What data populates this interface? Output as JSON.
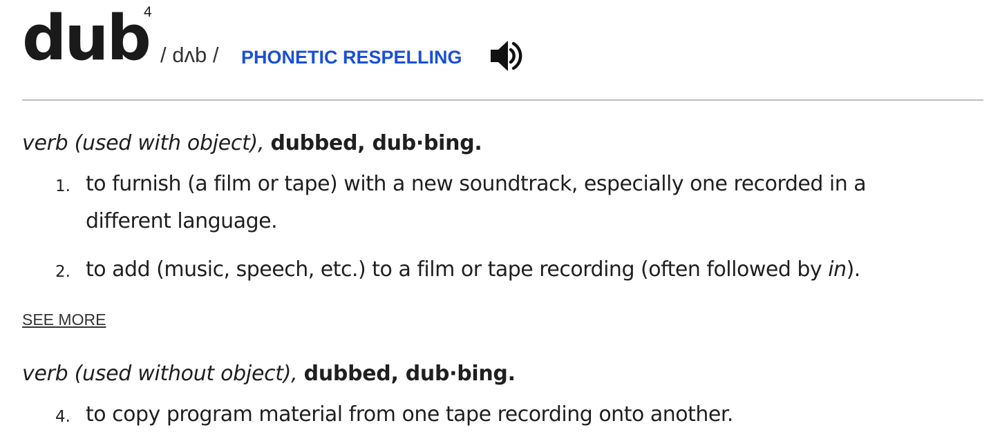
{
  "entry": {
    "headword": "dub",
    "homograph_number": "4",
    "pronunciation": "/ dʌb /",
    "respelling_link": "PHONETIC RESPELLING",
    "audio_icon": "speaker-icon"
  },
  "groups": [
    {
      "pos": "verb (used with object),",
      "forms": "dubbed, dub·bing.",
      "senses": [
        {
          "number": "1.",
          "definition": "to furnish (a film or tape) with a new soundtrack, especially one recorded in a different language."
        },
        {
          "number": "2.",
          "definition_before": "to add (music, speech, etc.) to a film or tape recording (often followed by ",
          "definition_italic": "in",
          "definition_after": ")."
        }
      ],
      "see_more": "SEE MORE"
    },
    {
      "pos": "verb (used without object),",
      "forms": "dubbed, dub·bing.",
      "senses": [
        {
          "number": "4.",
          "definition": "to copy program material from one tape recording onto another."
        }
      ]
    }
  ],
  "colors": {
    "link": "#1a4fd6",
    "text": "#1f1f1f",
    "rule": "#bdbdbd"
  }
}
